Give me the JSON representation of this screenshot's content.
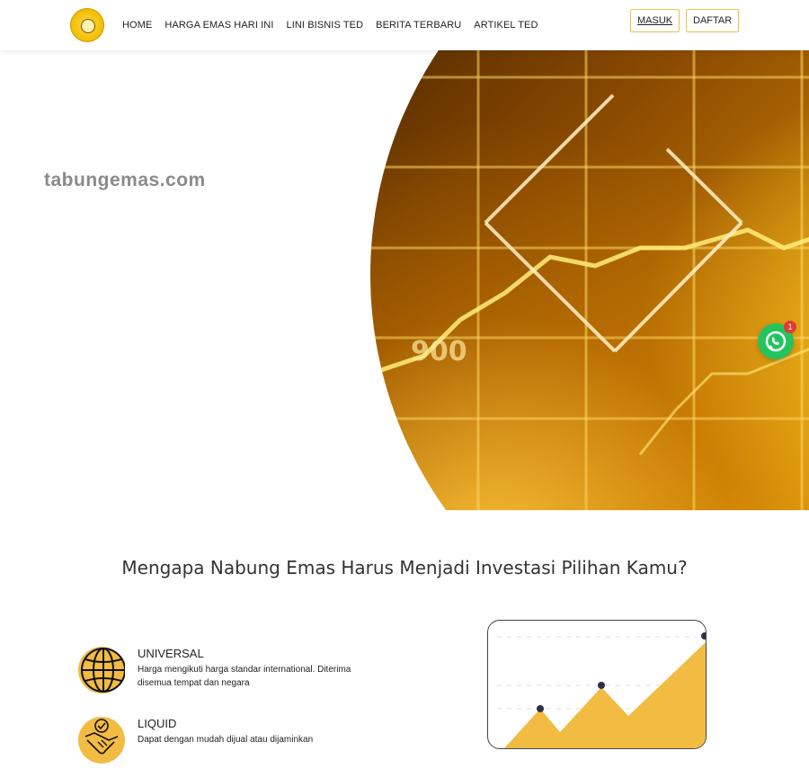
{
  "header": {
    "nav": [
      "HOME",
      "HARGA EMAS HARI INI",
      "LINI BISNIS TED",
      "BERITA TERBARU",
      "ARTIKEL TED"
    ],
    "login": "MASUK",
    "register": "DAFTAR"
  },
  "hero": {
    "brand": "tabungemas.com",
    "chart_number": "900"
  },
  "whatsapp": {
    "badge_count": "1"
  },
  "section": {
    "title": "Mengapa Nabung Emas Harus Menjadi Investasi Pilihan Kamu?",
    "features": [
      {
        "title": "UNIVERSAL",
        "desc": "Harga mengikuti harga standar international. Diterima disemua tempat dan negara",
        "icon": "globe-icon"
      },
      {
        "title": "LIQUID",
        "desc": "Dapat dengan mudah dijual atau dijaminkan",
        "icon": "handshake-icon"
      }
    ]
  },
  "colors": {
    "accent": "#f2bb42",
    "button_border": "#e8c44a",
    "whatsapp": "#23c45e"
  }
}
